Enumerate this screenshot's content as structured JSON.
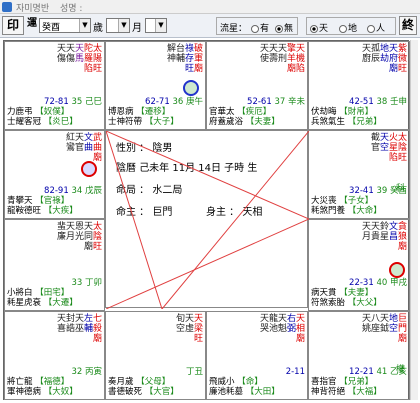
{
  "window": {
    "title1": "자미명반",
    "title2": "성명 :"
  },
  "toolbar": {
    "print_label": "印",
    "year_label": "運",
    "year_value": "癸酉",
    "year_unit": "歲",
    "month_value": "",
    "month_unit": "月",
    "day_value": "",
    "end_label": "終",
    "flow_label": "流星：",
    "flow_opt1": "有",
    "flow_opt2": "無",
    "sel_opt1": "天",
    "sel_opt2": "地",
    "sel_opt3": "人"
  },
  "center": {
    "gender_label": "性別",
    "gender": "陰男",
    "birth_label": "陰曆",
    "birth": "己未年 11月 14日 子時 生",
    "bureau_label": "命局",
    "bureau": "水二局",
    "lifelord_label": "命主",
    "lifelord": "巨門",
    "bodylord_label": "身主",
    "bodylord": "天相"
  },
  "palaces": [
    {
      "ages": "72-81",
      "age2": "35",
      "stem": "己巳",
      "name": "【奴僕】",
      "sub": "【炎巳】",
      "gods": "力鹿弔",
      "gods2": "士耀客冠"
    },
    {
      "ages": "62-71",
      "age2": "36",
      "stem": "庚午",
      "name": "【遷移】",
      "sub": "【大子】",
      "gods": "博恩病",
      "gods2": "士神符帶"
    },
    {
      "ages": "52-61",
      "age2": "37",
      "stem": "辛未",
      "name": "【疾厄】",
      "sub": "【夫妻】",
      "gods": "官華太",
      "gods2": "府蓋歲浴"
    },
    {
      "ages": "42-51",
      "age2": "38",
      "stem": "壬申",
      "name": "【財帛】",
      "sub": "【兄弟】",
      "gods": "伏劫晦",
      "gods2": "兵煞氣生"
    },
    {
      "ages": "82-91",
      "age2": "34",
      "stem": "戊辰",
      "name": "【官祿】",
      "sub": "【大疾】",
      "gods": "青攀天",
      "gods2": "龍鞍德旺"
    },
    {
      "ages": "32-41",
      "age2": "39",
      "stem": "癸酉",
      "name": "【子女】",
      "sub": "【大命】",
      "gods": "大災喪",
      "gods2": "耗煞門養"
    },
    {
      "ages": "",
      "age2": "33",
      "stem": "丁卯",
      "name": "【田宅】",
      "sub": "【大遷】",
      "gods": "小將白",
      "gods2": "耗星虎衰"
    },
    {
      "ages": "22-31",
      "age2": "40",
      "stem": "甲戌",
      "name": "【夫妻】",
      "sub": "【大父】",
      "gods": "病天貫",
      "gods2": "符煞索胎"
    },
    {
      "ages": "",
      "age2": "32",
      "stem": "丙寅",
      "name": "【福德】",
      "sub": "【大奴】",
      "gods": "將亡龍",
      "gods2": "軍神德病"
    },
    {
      "ages": "",
      "age2": "",
      "stem": "丁丑",
      "name": "【父母】",
      "sub": "【大官】",
      "gods": "奏月歲",
      "gods2": "書德破死"
    },
    {
      "ages": "2-11",
      "age2": "",
      "stem": "",
      "name": "【命】",
      "sub": "【大田】",
      "gods": "飛威小",
      "gods2": "廉池耗墓"
    },
    {
      "ages": "12-21",
      "age2": "41",
      "stem": "乙亥",
      "name": "【兄弟】",
      "sub": "【大福】",
      "gods": "喜指官",
      "gods2": "神背符絕"
    }
  ],
  "colors": {
    "accent": "#2f6fc7",
    "green": "#1a8a1a",
    "red": "#d00000",
    "blue": "#0000aa"
  }
}
